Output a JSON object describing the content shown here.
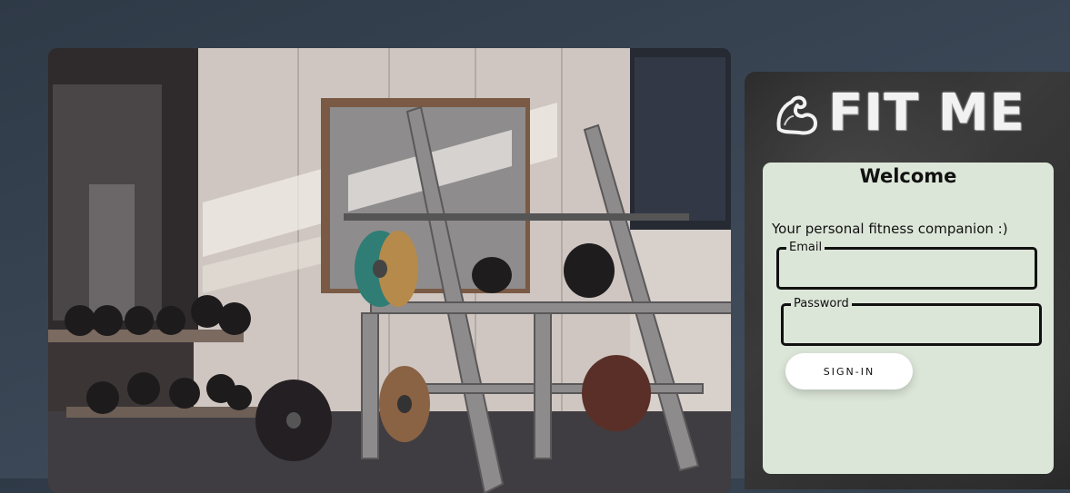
{
  "hero": {
    "image_name": "gym-squat-rack-photo"
  },
  "brand": {
    "logo_icon": "flexing-arm-icon",
    "name": "FIT ME"
  },
  "login": {
    "title": "Welcome",
    "subtitle": "Your personal fitness companion :)",
    "email_label": "Email",
    "email_value": "",
    "password_label": "Password",
    "password_value": "",
    "signin_label": "SIGN-IN"
  },
  "colors": {
    "background": "#37424f",
    "card": "#dce6d8",
    "button": "#ffffff",
    "field_border": "#111111"
  }
}
